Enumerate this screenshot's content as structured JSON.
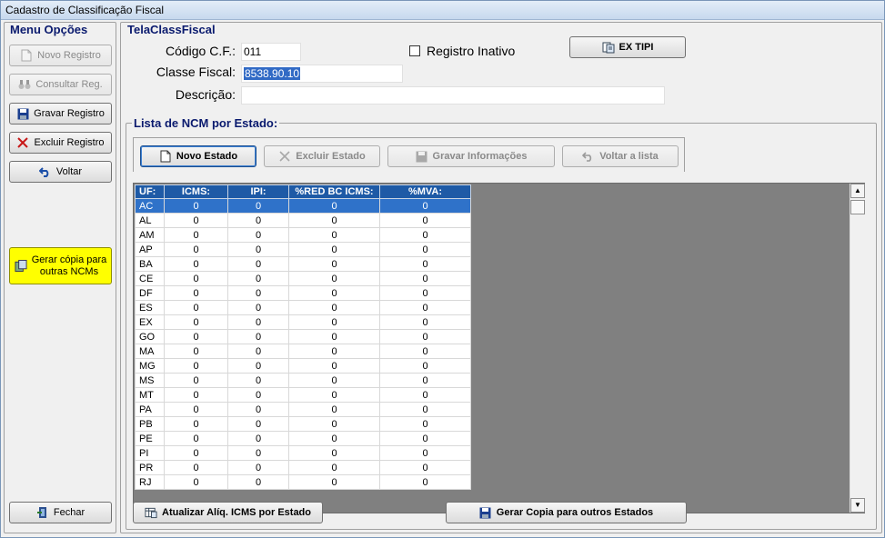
{
  "window": {
    "title": "Cadastro de Classificação Fiscal"
  },
  "menu": {
    "title": "Menu Opções",
    "novo_registro": "Novo Registro",
    "consultar": "Consultar Reg.",
    "gravar": "Gravar Registro",
    "excluir": "Excluir Registro",
    "voltar": "Voltar",
    "gerar_copia_line1": "Gerar cópia para",
    "gerar_copia_line2": "outras NCMs",
    "fechar": "Fechar"
  },
  "form": {
    "title": "TelaClassFiscal",
    "codigo_label": "Código C.F.:",
    "codigo_value": "011",
    "classe_label": "Classe Fiscal:",
    "classe_value": "8538.90.10",
    "descricao_label": "Descrição:",
    "descricao_value": "",
    "registro_inativo_label": "Registro Inativo",
    "registro_inativo_checked": false,
    "ex_tipi_button": "EX TIPI"
  },
  "ncm": {
    "title": "Lista de NCM por Estado:",
    "novo_estado": "Novo Estado",
    "excluir_estado": "Excluir Estado",
    "gravar_info": "Gravar Informações",
    "voltar_lista": "Voltar a lista",
    "columns": [
      "UF:",
      "ICMS:",
      "IPI:",
      "%RED BC ICMS:",
      "%MVA:"
    ],
    "rows": [
      [
        "AC",
        "0",
        "0",
        "0",
        "0"
      ],
      [
        "AL",
        "0",
        "0",
        "0",
        "0"
      ],
      [
        "AM",
        "0",
        "0",
        "0",
        "0"
      ],
      [
        "AP",
        "0",
        "0",
        "0",
        "0"
      ],
      [
        "BA",
        "0",
        "0",
        "0",
        "0"
      ],
      [
        "CE",
        "0",
        "0",
        "0",
        "0"
      ],
      [
        "DF",
        "0",
        "0",
        "0",
        "0"
      ],
      [
        "ES",
        "0",
        "0",
        "0",
        "0"
      ],
      [
        "EX",
        "0",
        "0",
        "0",
        "0"
      ],
      [
        "GO",
        "0",
        "0",
        "0",
        "0"
      ],
      [
        "MA",
        "0",
        "0",
        "0",
        "0"
      ],
      [
        "MG",
        "0",
        "0",
        "0",
        "0"
      ],
      [
        "MS",
        "0",
        "0",
        "0",
        "0"
      ],
      [
        "MT",
        "0",
        "0",
        "0",
        "0"
      ],
      [
        "PA",
        "0",
        "0",
        "0",
        "0"
      ],
      [
        "PB",
        "0",
        "0",
        "0",
        "0"
      ],
      [
        "PE",
        "0",
        "0",
        "0",
        "0"
      ],
      [
        "PI",
        "0",
        "0",
        "0",
        "0"
      ],
      [
        "PR",
        "0",
        "0",
        "0",
        "0"
      ],
      [
        "RJ",
        "0",
        "0",
        "0",
        "0"
      ]
    ],
    "selected_row": 0,
    "atualizar_button": "Atualizar Alíq. ICMS por Estado",
    "gerar_copia_estados": "Gerar Copia para outros Estados"
  },
  "icons": {
    "novo": "new-document-icon",
    "consultar": "binoculars-icon",
    "gravar": "floppy-disk-icon",
    "excluir": "red-x-icon",
    "voltar": "undo-arrow-icon",
    "copiar": "copy-documents-icon",
    "fechar": "exit-door-icon"
  }
}
